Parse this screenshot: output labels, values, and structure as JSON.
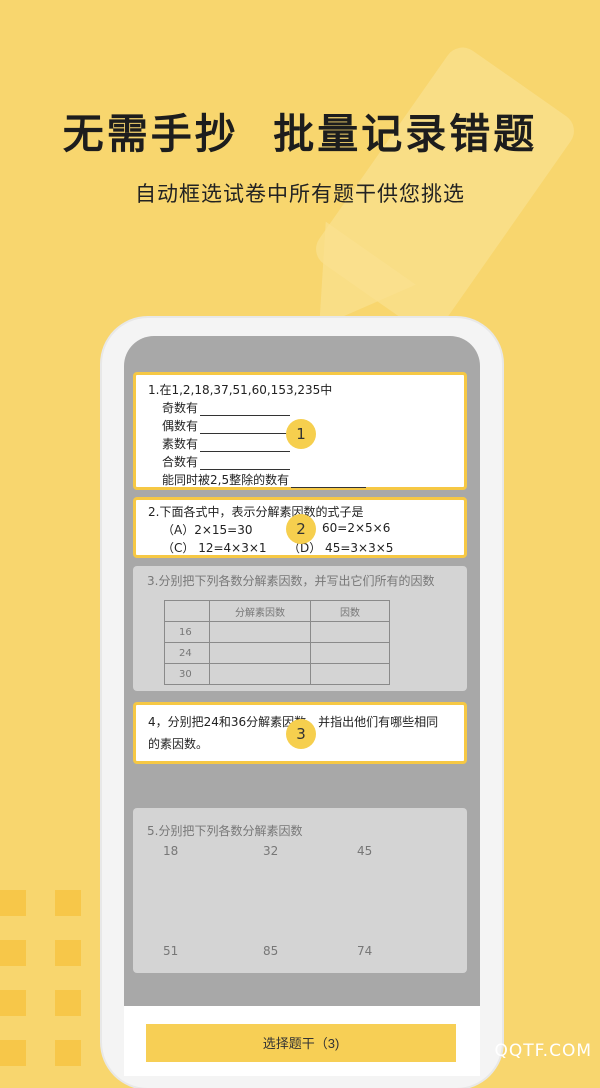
{
  "hero": {
    "title": "无需手抄  批量记录错题",
    "subtitle": "自动框选试卷中所有题干供您挑选"
  },
  "questions": {
    "q1": {
      "title": "1.在1,2,18,37,51,60,153,235中",
      "lines": [
        "奇数有",
        "偶数有",
        "素数有",
        "合数有",
        "能同时被2,5整除的数有"
      ],
      "badge": "1"
    },
    "q2": {
      "title": "2.下面各式中，表示分解素因数的式子是",
      "opt_a": "（A）2×15=30",
      "opt_b": "60=2×5×6",
      "opt_c": "（C） 12=4×3×1",
      "opt_d": "（D） 45=3×3×5",
      "badge": "2"
    },
    "q3": {
      "title": "3.分别把下列各数分解素因数，并写出它们所有的因数",
      "headers": [
        "",
        "分解素因数",
        "因数"
      ],
      "rows": [
        "16",
        "24",
        "30"
      ]
    },
    "q4": {
      "line1": "4，分别把24和36分解素因数，并指出他们有哪些相同",
      "line2": "的素因数。",
      "badge": "3"
    },
    "q5": {
      "title": "5.分别把下列各数分解素因数",
      "numbers": [
        "18",
        "32",
        "45",
        "51",
        "85",
        "74"
      ]
    }
  },
  "action": {
    "button_label": "选择题干（3)"
  },
  "watermark": "QQTF.COM",
  "colors": {
    "background": "#F8D66E",
    "accent": "#F6C844",
    "button": "#F7CF55"
  }
}
